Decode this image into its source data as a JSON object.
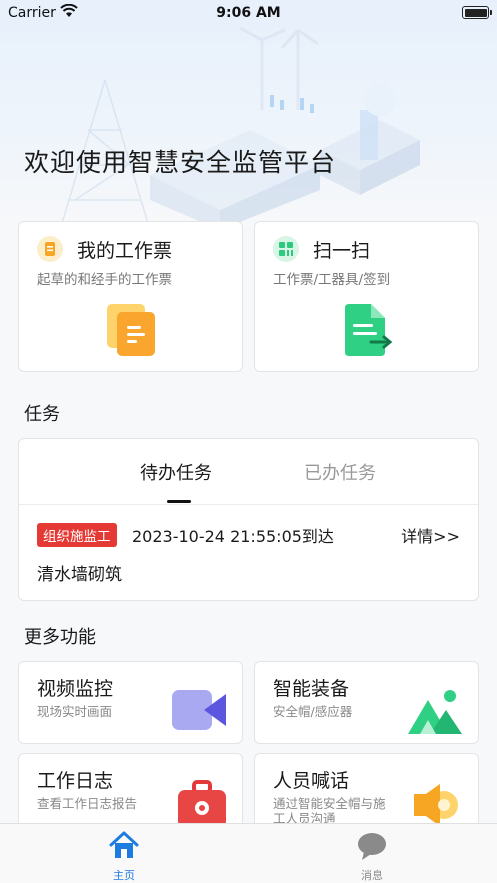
{
  "status_bar": {
    "carrier": "Carrier",
    "time": "9:06 AM"
  },
  "welcome": "欢迎使用智慧安全监管平台",
  "quick_cards": [
    {
      "title": "我的工作票",
      "subtitle": "起草的和经手的工作票",
      "icon": "ticket-icon",
      "color": "#f7a623"
    },
    {
      "title": "扫一扫",
      "subtitle": "工作票/工器具/签到",
      "icon": "scan-icon",
      "color": "#2dc97e"
    }
  ],
  "tasks": {
    "section_title": "任务",
    "tabs": [
      {
        "label": "待办任务",
        "active": true
      },
      {
        "label": "已办任务",
        "active": false
      }
    ],
    "items": [
      {
        "tag": "组织施监工",
        "time": "2023-10-24 21:55:05到达",
        "detail": "详情>>",
        "name": "清水墙砌筑"
      }
    ]
  },
  "more": {
    "section_title": "更多功能",
    "features": [
      {
        "title": "视频监控",
        "subtitle": "现场实时画面",
        "icon": "video-camera-icon"
      },
      {
        "title": "智能装备",
        "subtitle": "安全帽/感应器",
        "icon": "mountain-image-icon"
      },
      {
        "title": "工作日志",
        "subtitle": "查看工作日志报告",
        "icon": "toolbox-icon"
      },
      {
        "title": "人员喊话",
        "subtitle": "通过智能安全帽与施工人员沟通",
        "icon": "speaker-icon"
      }
    ]
  },
  "tabbar": [
    {
      "label": "主页",
      "icon": "home-icon",
      "active": true,
      "color": "#1e7be0"
    },
    {
      "label": "消息",
      "icon": "chat-icon",
      "active": false,
      "color": "#8a8a8a"
    }
  ]
}
